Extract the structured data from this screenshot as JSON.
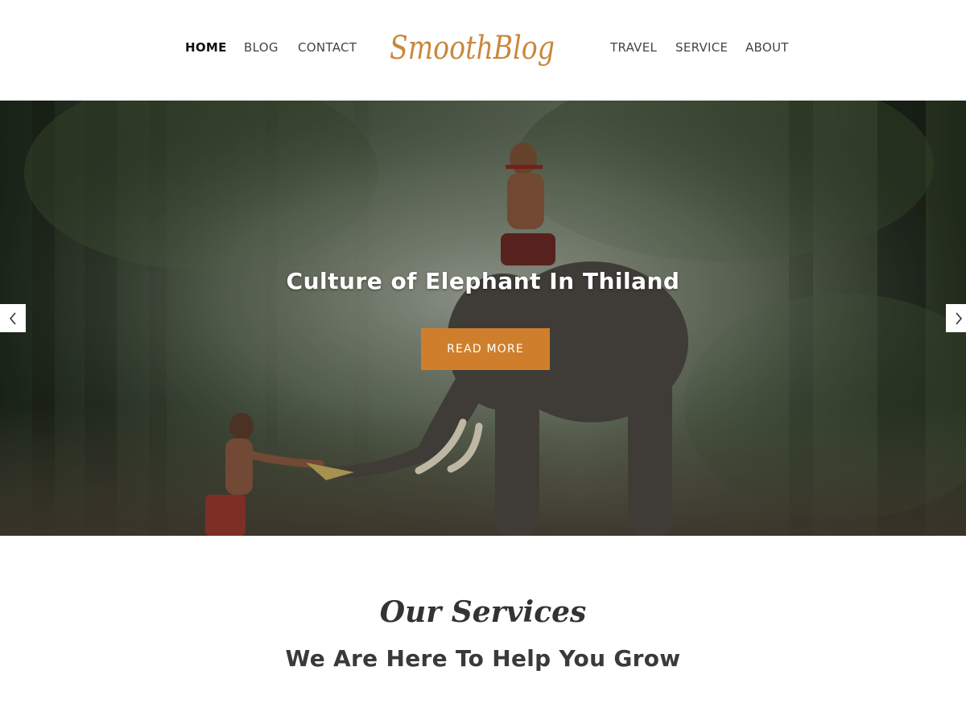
{
  "nav": {
    "left": [
      {
        "label": "HOME",
        "active": true
      },
      {
        "label": "BLOG",
        "active": false
      },
      {
        "label": "CONTACT",
        "active": false
      }
    ],
    "right": [
      {
        "label": "TRAVEL",
        "active": false
      },
      {
        "label": "SERVICE",
        "active": false
      },
      {
        "label": "ABOUT",
        "active": false
      }
    ]
  },
  "logo": {
    "text": "SmoothBlog",
    "color": "#c9883c"
  },
  "hero": {
    "title": "Culture of Elephant In Thiland",
    "button_label": "READ MORE",
    "button_color": "#cf7f2b",
    "prev_icon": "chevron-left-icon",
    "next_icon": "chevron-right-icon"
  },
  "services": {
    "script_title": "Our Services",
    "heading": "We Are Here To Help You Grow"
  }
}
